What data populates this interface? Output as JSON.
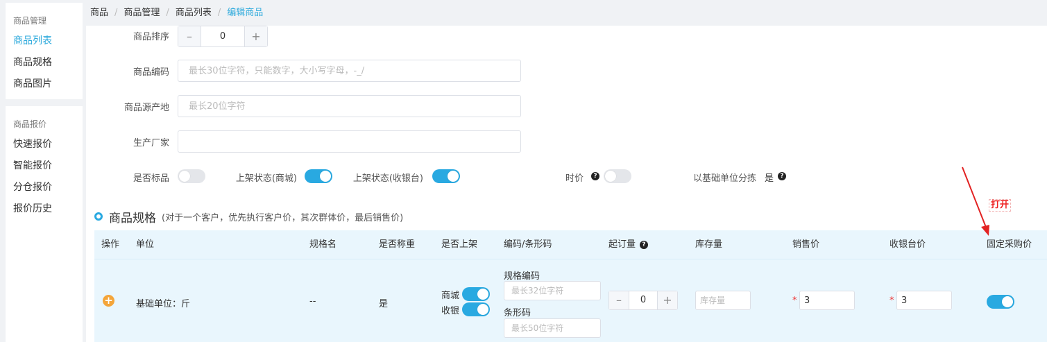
{
  "sidebar": {
    "groups": [
      {
        "title": "商品管理",
        "items": [
          "商品列表",
          "商品规格",
          "商品图片"
        ]
      },
      {
        "title": "商品报价",
        "items": [
          "快速报价",
          "智能报价",
          "分仓报价",
          "报价历史"
        ]
      }
    ],
    "active_item": "商品列表"
  },
  "breadcrumb": [
    "商品",
    "商品管理",
    "商品列表",
    "编辑商品"
  ],
  "form": {
    "sort_label": "商品排序",
    "sort_value": "0",
    "stepper_minus": "–",
    "stepper_plus": "+",
    "code_label": "商品编码",
    "code_placeholder": "最长30位字符，只能数字，大小写字母，-_/",
    "origin_label": "商品源产地",
    "origin_placeholder": "最长20位字符",
    "maker_label": "生产厂家",
    "maker_value": "",
    "is_standard_label": "是否标品",
    "is_standard": false,
    "mall_status_label": "上架状态(商城)",
    "mall_status": true,
    "pos_status_label": "上架状态(收银台)",
    "pos_status": true,
    "market_price_label": "时价",
    "market_price": false,
    "sort_by_base_label": "以基础单位分拣",
    "sort_by_base_value": "是",
    "help_glyph": "?"
  },
  "spec_section": {
    "title": "商品规格",
    "subtitle": "(对于一个客户，优先执行客户价，其次群体价，最后销售价)",
    "columns": [
      "操作",
      "单位",
      "规格名",
      "是否称重",
      "是否上架",
      "编码/条形码",
      "起订量",
      "库存量",
      "销售价",
      "收银台价",
      "固定采购价"
    ],
    "row": {
      "add_glyph": "+",
      "unit": "基础单位：斤",
      "spec_name": "--",
      "is_weighed": "是",
      "mall_label": "商城",
      "mall_on": true,
      "pos_label": "收银",
      "pos_on": true,
      "spec_code_label": "规格编码",
      "spec_code_placeholder": "最长32位字符",
      "barcode_label": "条形码",
      "barcode_placeholder": "最长50位字符",
      "min_order": "0",
      "stock_placeholder": "库存量",
      "sale_price": "3",
      "pos_price": "3",
      "fixed_purchase_on": true
    }
  },
  "annotation": {
    "label": "打开",
    "color": "#e22222"
  },
  "colors": {
    "accent": "#29a9e1",
    "active_link": "#2eaadc",
    "add_icon": "#f4a53a",
    "required": "#e33333"
  }
}
